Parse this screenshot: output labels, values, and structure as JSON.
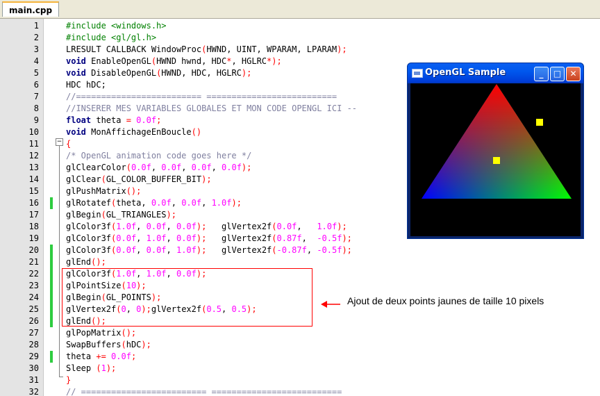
{
  "tab": {
    "label": "main.cpp"
  },
  "lines": [
    {
      "n": "1",
      "changed": false,
      "tokens": [
        {
          "c": "pp",
          "t": "#include <windows.h>"
        }
      ]
    },
    {
      "n": "2",
      "changed": false,
      "tokens": [
        {
          "c": "pp",
          "t": "#include <gl/gl.h>"
        }
      ]
    },
    {
      "n": "3",
      "changed": false,
      "tokens": [
        {
          "c": "id",
          "t": "LRESULT CALLBACK WindowProc"
        },
        {
          "c": "op",
          "t": "("
        },
        {
          "c": "id",
          "t": "HWND, UINT, WPARAM, LPARAM"
        },
        {
          "c": "op",
          "t": ");"
        }
      ]
    },
    {
      "n": "4",
      "changed": false,
      "tokens": [
        {
          "c": "kw",
          "t": "void"
        },
        {
          "c": "id",
          "t": " EnableOpenGL"
        },
        {
          "c": "op",
          "t": "("
        },
        {
          "c": "id",
          "t": "HWND hwnd, HDC"
        },
        {
          "c": "op",
          "t": "*"
        },
        {
          "c": "id",
          "t": ", HGLRC"
        },
        {
          "c": "op",
          "t": "*);"
        }
      ]
    },
    {
      "n": "5",
      "changed": false,
      "tokens": [
        {
          "c": "kw",
          "t": "void"
        },
        {
          "c": "id",
          "t": " DisableOpenGL"
        },
        {
          "c": "op",
          "t": "("
        },
        {
          "c": "id",
          "t": "HWND, HDC, HGLRC"
        },
        {
          "c": "op",
          "t": ");"
        }
      ]
    },
    {
      "n": "6",
      "changed": false,
      "tokens": [
        {
          "c": "id",
          "t": "HDC hDC;"
        }
      ]
    },
    {
      "n": "7",
      "changed": false,
      "tokens": [
        {
          "c": "cm",
          "t": "//========================= =========================="
        }
      ]
    },
    {
      "n": "8",
      "changed": false,
      "tokens": [
        {
          "c": "cm",
          "t": "//INSERER MES VARIABLES GLOBALES ET MON CODE OPENGL ICI --"
        }
      ]
    },
    {
      "n": "9",
      "changed": false,
      "tokens": [
        {
          "c": "kw",
          "t": "float"
        },
        {
          "c": "id",
          "t": " theta "
        },
        {
          "c": "op",
          "t": "="
        },
        {
          "c": "id",
          "t": " "
        },
        {
          "c": "num",
          "t": "0.0f"
        },
        {
          "c": "op",
          "t": ";"
        }
      ]
    },
    {
      "n": "10",
      "changed": false,
      "tokens": [
        {
          "c": "kw",
          "t": "void"
        },
        {
          "c": "id",
          "t": " MonAffichageEnBoucle"
        },
        {
          "c": "op",
          "t": "()"
        }
      ]
    },
    {
      "n": "11",
      "changed": false,
      "tokens": [
        {
          "c": "op",
          "t": "{"
        }
      ]
    },
    {
      "n": "12",
      "changed": false,
      "tokens": [
        {
          "c": "cm",
          "t": "/* OpenGL animation code goes here */"
        }
      ]
    },
    {
      "n": "13",
      "changed": false,
      "tokens": [
        {
          "c": "id",
          "t": "glClearColor"
        },
        {
          "c": "op",
          "t": "("
        },
        {
          "c": "num",
          "t": "0.0f"
        },
        {
          "c": "id",
          "t": ", "
        },
        {
          "c": "num",
          "t": "0.0f"
        },
        {
          "c": "id",
          "t": ", "
        },
        {
          "c": "num",
          "t": "0.0f"
        },
        {
          "c": "id",
          "t": ", "
        },
        {
          "c": "num",
          "t": "0.0f"
        },
        {
          "c": "op",
          "t": ");"
        }
      ]
    },
    {
      "n": "14",
      "changed": false,
      "tokens": [
        {
          "c": "id",
          "t": "glClear"
        },
        {
          "c": "op",
          "t": "("
        },
        {
          "c": "id",
          "t": "GL_COLOR_BUFFER_BIT"
        },
        {
          "c": "op",
          "t": ");"
        }
      ]
    },
    {
      "n": "15",
      "changed": false,
      "tokens": [
        {
          "c": "id",
          "t": "glPushMatrix"
        },
        {
          "c": "op",
          "t": "();"
        }
      ]
    },
    {
      "n": "16",
      "changed": true,
      "tokens": [
        {
          "c": "id",
          "t": "glRotatef"
        },
        {
          "c": "op",
          "t": "("
        },
        {
          "c": "id",
          "t": "theta, "
        },
        {
          "c": "num",
          "t": "0.0f"
        },
        {
          "c": "id",
          "t": ", "
        },
        {
          "c": "num",
          "t": "0.0f"
        },
        {
          "c": "id",
          "t": ", "
        },
        {
          "c": "num",
          "t": "1.0f"
        },
        {
          "c": "op",
          "t": ");"
        }
      ]
    },
    {
      "n": "17",
      "changed": false,
      "tokens": [
        {
          "c": "id",
          "t": "glBegin"
        },
        {
          "c": "op",
          "t": "("
        },
        {
          "c": "id",
          "t": "GL_TRIANGLES"
        },
        {
          "c": "op",
          "t": ");"
        }
      ]
    },
    {
      "n": "18",
      "changed": false,
      "tokens": [
        {
          "c": "id",
          "t": "glColor3f"
        },
        {
          "c": "op",
          "t": "("
        },
        {
          "c": "num",
          "t": "1.0f"
        },
        {
          "c": "id",
          "t": ", "
        },
        {
          "c": "num",
          "t": "0.0f"
        },
        {
          "c": "id",
          "t": ", "
        },
        {
          "c": "num",
          "t": "0.0f"
        },
        {
          "c": "op",
          "t": ");"
        },
        {
          "c": "id",
          "t": "   glVertex2f"
        },
        {
          "c": "op",
          "t": "("
        },
        {
          "c": "num",
          "t": "0.0f"
        },
        {
          "c": "id",
          "t": ",   "
        },
        {
          "c": "num",
          "t": "1.0f"
        },
        {
          "c": "op",
          "t": ");"
        }
      ]
    },
    {
      "n": "19",
      "changed": false,
      "tokens": [
        {
          "c": "id",
          "t": "glColor3f"
        },
        {
          "c": "op",
          "t": "("
        },
        {
          "c": "num",
          "t": "0.0f"
        },
        {
          "c": "id",
          "t": ", "
        },
        {
          "c": "num",
          "t": "1.0f"
        },
        {
          "c": "id",
          "t": ", "
        },
        {
          "c": "num",
          "t": "0.0f"
        },
        {
          "c": "op",
          "t": ");"
        },
        {
          "c": "id",
          "t": "   glVertex2f"
        },
        {
          "c": "op",
          "t": "("
        },
        {
          "c": "num",
          "t": "0.87f"
        },
        {
          "c": "id",
          "t": ",  "
        },
        {
          "c": "num",
          "t": "-0.5f"
        },
        {
          "c": "op",
          "t": ");"
        }
      ]
    },
    {
      "n": "20",
      "changed": true,
      "tokens": [
        {
          "c": "id",
          "t": "glColor3f"
        },
        {
          "c": "op",
          "t": "("
        },
        {
          "c": "num",
          "t": "0.0f"
        },
        {
          "c": "id",
          "t": ", "
        },
        {
          "c": "num",
          "t": "0.0f"
        },
        {
          "c": "id",
          "t": ", "
        },
        {
          "c": "num",
          "t": "1.0f"
        },
        {
          "c": "op",
          "t": ");"
        },
        {
          "c": "id",
          "t": "   glVertex2f"
        },
        {
          "c": "op",
          "t": "("
        },
        {
          "c": "num",
          "t": "-0.87f"
        },
        {
          "c": "id",
          "t": ", "
        },
        {
          "c": "num",
          "t": "-0.5f"
        },
        {
          "c": "op",
          "t": ");"
        }
      ]
    },
    {
      "n": "21",
      "changed": true,
      "tokens": [
        {
          "c": "id",
          "t": "glEnd"
        },
        {
          "c": "op",
          "t": "();"
        }
      ]
    },
    {
      "n": "22",
      "changed": true,
      "tokens": [
        {
          "c": "id",
          "t": "glColor3f"
        },
        {
          "c": "op",
          "t": "("
        },
        {
          "c": "num",
          "t": "1.0f"
        },
        {
          "c": "id",
          "t": ", "
        },
        {
          "c": "num",
          "t": "1.0f"
        },
        {
          "c": "id",
          "t": ", "
        },
        {
          "c": "num",
          "t": "0.0f"
        },
        {
          "c": "op",
          "t": ");"
        }
      ]
    },
    {
      "n": "23",
      "changed": true,
      "tokens": [
        {
          "c": "id",
          "t": "glPointSize"
        },
        {
          "c": "op",
          "t": "("
        },
        {
          "c": "num",
          "t": "10"
        },
        {
          "c": "op",
          "t": ");"
        }
      ]
    },
    {
      "n": "24",
      "changed": true,
      "tokens": [
        {
          "c": "id",
          "t": "glBegin"
        },
        {
          "c": "op",
          "t": "("
        },
        {
          "c": "id",
          "t": "GL_POINTS"
        },
        {
          "c": "op",
          "t": ");"
        }
      ]
    },
    {
      "n": "25",
      "changed": true,
      "tokens": [
        {
          "c": "id",
          "t": "glVertex2f"
        },
        {
          "c": "op",
          "t": "("
        },
        {
          "c": "num",
          "t": "0"
        },
        {
          "c": "id",
          "t": ", "
        },
        {
          "c": "num",
          "t": "0"
        },
        {
          "c": "op",
          "t": ");"
        },
        {
          "c": "id",
          "t": "glVertex2f"
        },
        {
          "c": "op",
          "t": "("
        },
        {
          "c": "num",
          "t": "0.5"
        },
        {
          "c": "id",
          "t": ", "
        },
        {
          "c": "num",
          "t": "0.5"
        },
        {
          "c": "op",
          "t": ");"
        }
      ]
    },
    {
      "n": "26",
      "changed": true,
      "tokens": [
        {
          "c": "id",
          "t": "glEnd"
        },
        {
          "c": "op",
          "t": "();"
        }
      ]
    },
    {
      "n": "27",
      "changed": false,
      "tokens": [
        {
          "c": "id",
          "t": "glPopMatrix"
        },
        {
          "c": "op",
          "t": "();"
        }
      ]
    },
    {
      "n": "28",
      "changed": false,
      "tokens": [
        {
          "c": "id",
          "t": "SwapBuffers"
        },
        {
          "c": "op",
          "t": "("
        },
        {
          "c": "id",
          "t": "hDC"
        },
        {
          "c": "op",
          "t": ");"
        }
      ]
    },
    {
      "n": "29",
      "changed": true,
      "tokens": [
        {
          "c": "id",
          "t": "theta "
        },
        {
          "c": "op",
          "t": "+="
        },
        {
          "c": "id",
          "t": " "
        },
        {
          "c": "num",
          "t": "0.0f"
        },
        {
          "c": "op",
          "t": ";"
        }
      ]
    },
    {
      "n": "30",
      "changed": false,
      "tokens": [
        {
          "c": "id",
          "t": "Sleep "
        },
        {
          "c": "op",
          "t": "("
        },
        {
          "c": "num",
          "t": "1"
        },
        {
          "c": "op",
          "t": ");"
        }
      ]
    },
    {
      "n": "31",
      "changed": false,
      "tokens": [
        {
          "c": "op",
          "t": "}"
        }
      ]
    },
    {
      "n": "32",
      "changed": false,
      "tokens": [
        {
          "c": "cm",
          "t": "// ========================= =========================="
        }
      ]
    }
  ],
  "annotation": {
    "text": "Ajout de deux points jaunes de taille 10 pixels",
    "color": "#ff0000"
  },
  "gl_window": {
    "title": "OpenGL Sample",
    "buttons": {
      "minimize": "_",
      "maximize": "□",
      "close": "✕"
    },
    "triangle_colors": [
      "#ff0000",
      "#00ff00",
      "#0000ff"
    ],
    "point_color": "#ffff00",
    "points": [
      [
        0,
        0
      ],
      [
        0.5,
        0.5
      ]
    ]
  },
  "colors": {
    "keyword": "#000080",
    "preprocessor": "#008000",
    "number": "#ff00ff",
    "comment": "#8080a0",
    "change_marker": "#2ecc40"
  }
}
